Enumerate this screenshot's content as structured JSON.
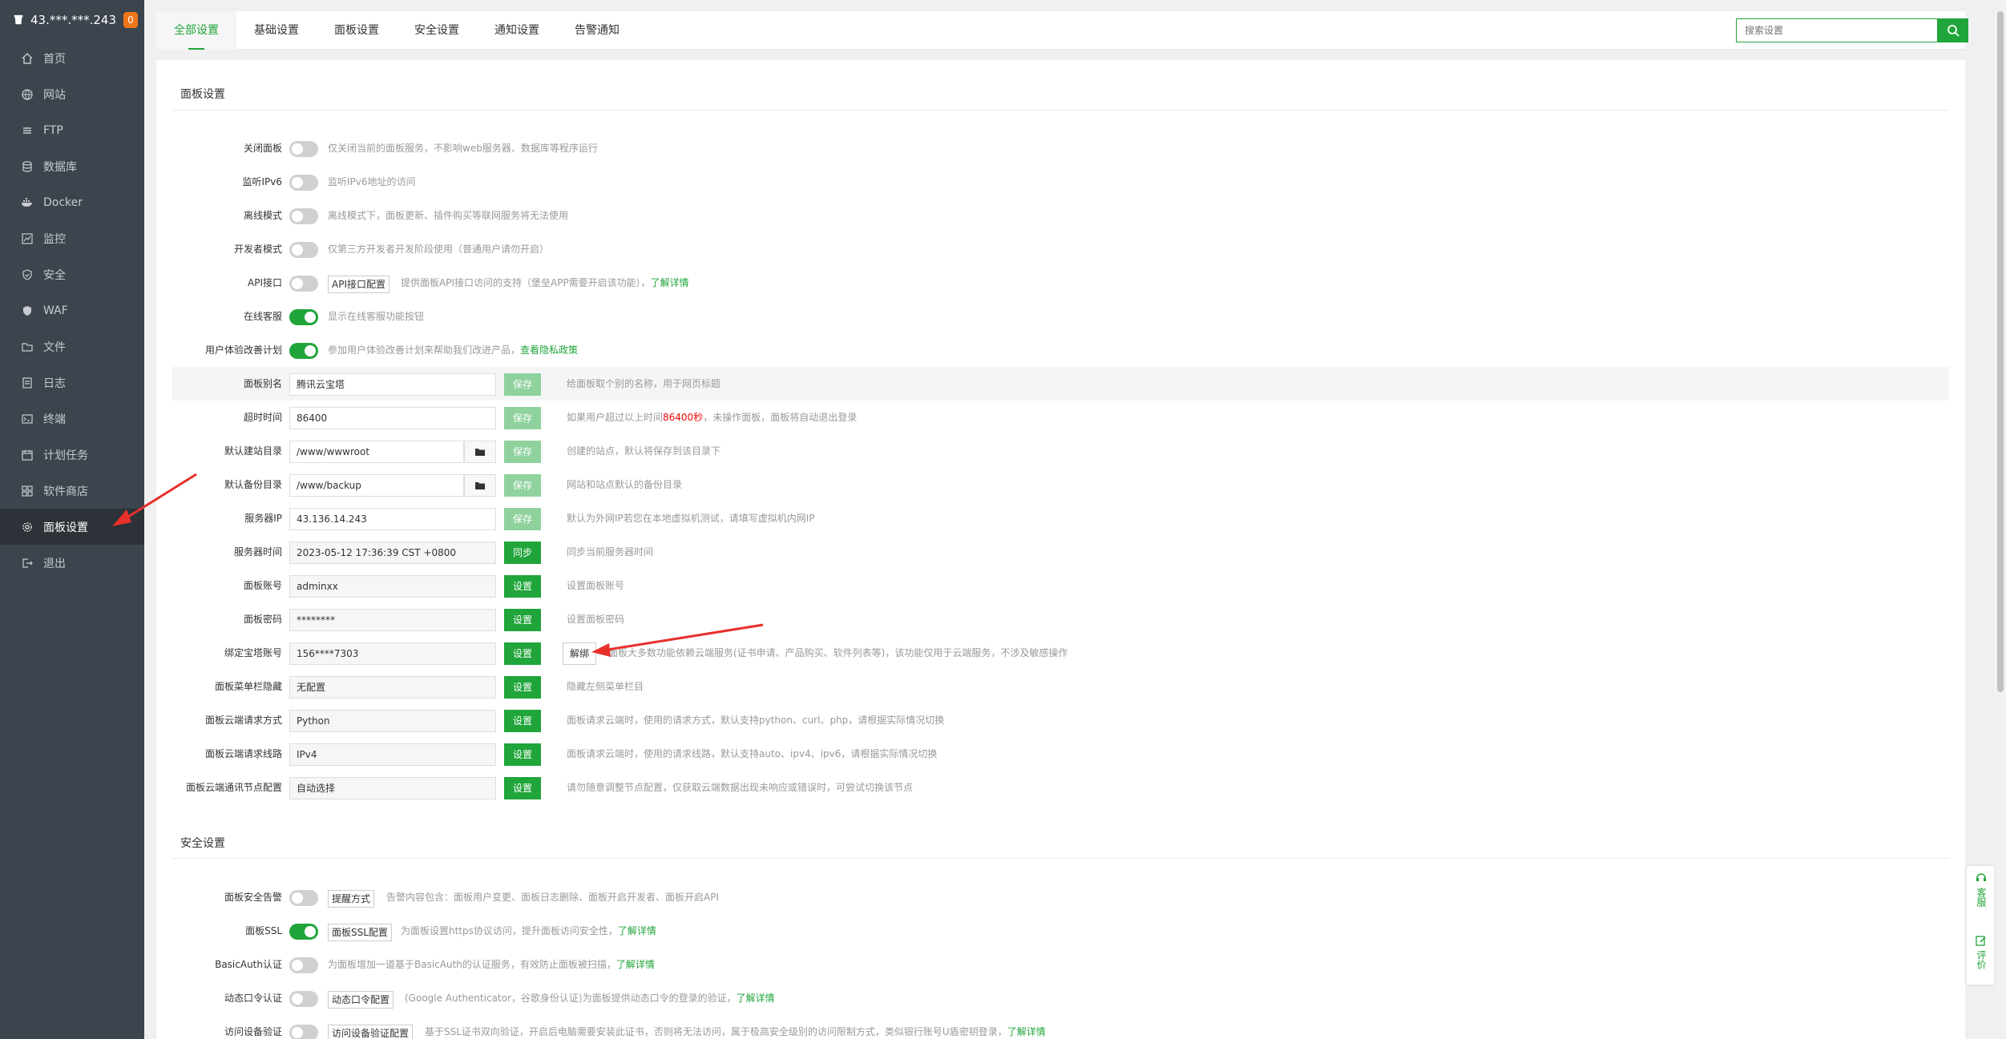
{
  "sidebar": {
    "server": "43.***.***.243",
    "badge": "0",
    "items": [
      {
        "label": "首页"
      },
      {
        "label": "网站"
      },
      {
        "label": "FTP"
      },
      {
        "label": "数据库"
      },
      {
        "label": "Docker"
      },
      {
        "label": "监控"
      },
      {
        "label": "安全"
      },
      {
        "label": "WAF"
      },
      {
        "label": "文件"
      },
      {
        "label": "日志"
      },
      {
        "label": "终端"
      },
      {
        "label": "计划任务"
      },
      {
        "label": "软件商店"
      },
      {
        "label": "面板设置"
      },
      {
        "label": "退出"
      }
    ]
  },
  "tabs": [
    "全部设置",
    "基础设置",
    "面板设置",
    "安全设置",
    "通知设置",
    "告警通知"
  ],
  "search": {
    "placeholder": "搜索设置"
  },
  "panel_section": {
    "title": "面板设置",
    "close_panel": {
      "label": "关闭面板",
      "desc": "仅关闭当前的面板服务，不影响web服务器、数据库等程序运行"
    },
    "ipv6": {
      "label": "监听IPv6",
      "desc": "监听IPv6地址的访问"
    },
    "offline": {
      "label": "离线模式",
      "desc": "离线模式下，面板更新、插件购买等联网服务将无法使用"
    },
    "dev_mode": {
      "label": "开发者模式",
      "desc": "仅第三方开发者开发阶段使用（普通用户请勿开启）"
    },
    "api": {
      "label": "API接口",
      "btn": "API接口配置",
      "desc": "提供面板API接口访问的支持（堡垒APP需要开启该功能），",
      "link": "了解详情"
    },
    "online_service": {
      "label": "在线客服",
      "desc": "显示在线客服功能按钮"
    },
    "ux_plan": {
      "label": "用户体验改善计划",
      "desc": "参加用户体验改善计划来帮助我们改进产品，",
      "link": "查看隐私政策"
    },
    "alias": {
      "label": "面板别名",
      "value": "腾讯云宝塔",
      "btn": "保存",
      "desc": "给面板取个别的名称，用于网页标题"
    },
    "timeout": {
      "label": "超时时间",
      "value": "86400",
      "btn": "保存",
      "desc_a": "如果用户超过以上时间",
      "desc_red": "86400秒",
      "desc_b": "，未操作面板，面板将自动退出登录"
    },
    "site_dir": {
      "label": "默认建站目录",
      "value": "/www/wwwroot",
      "btn": "保存",
      "desc": "创建的站点，默认将保存到该目录下"
    },
    "backup_dir": {
      "label": "默认备份目录",
      "value": "/www/backup",
      "btn": "保存",
      "desc": "网站和站点默认的备份目录"
    },
    "server_ip": {
      "label": "服务器IP",
      "value": "43.136.14.243",
      "btn": "保存",
      "desc": "默认为外网IP若您在本地虚拟机测试，请填写虚拟机内网IP"
    },
    "server_time": {
      "label": "服务器时间",
      "value": "2023-05-12 17:36:39 CST +0800",
      "btn": "同步",
      "desc": "同步当前服务器时间"
    },
    "account": {
      "label": "面板账号",
      "value": "adminxx",
      "btn": "设置",
      "desc": "设置面板账号"
    },
    "password": {
      "label": "面板密码",
      "value": "********",
      "btn": "设置",
      "desc": "设置面板密码"
    },
    "bt_account": {
      "label": "绑定宝塔账号",
      "value": "156****7303",
      "btn": "设置",
      "btn2": "解绑",
      "desc": "面板大多数功能依赖云端服务(证书申请、产品购买、软件列表等)，该功能仅用于云端服务，不涉及敏感操作"
    },
    "menu_hide": {
      "label": "面板菜单栏隐藏",
      "value": "无配置",
      "btn": "设置",
      "desc": "隐藏左侧菜单栏目"
    },
    "req_method": {
      "label": "面板云端请求方式",
      "value": "Python",
      "btn": "设置",
      "desc": "面板请求云端时，使用的请求方式，默认支持python、curl、php，请根据实际情况切换"
    },
    "req_line": {
      "label": "面板云端请求线路",
      "value": "IPv4",
      "btn": "设置",
      "desc": "面板请求云端时，使用的请求线路，默认支持auto、ipv4、ipv6，请根据实际情况切换"
    },
    "node": {
      "label": "面板云端通讯节点配置",
      "value": "自动选择",
      "btn": "设置",
      "desc": "请勿随意调整节点配置，仅获取云端数据出现未响应或错误时，可尝试切换该节点"
    }
  },
  "security_section": {
    "title": "安全设置",
    "alarm": {
      "label": "面板安全告警",
      "btn": "提醒方式",
      "desc": "告警内容包含：面板用户变更、面板日志删除、面板开启开发者、面板开启API"
    },
    "ssl": {
      "label": "面板SSL",
      "btn": "面板SSL配置",
      "desc": "为面板设置https协议访问，提升面板访问安全性，",
      "link": "了解详情"
    },
    "basic_auth": {
      "label": "BasicAuth认证",
      "desc": "为面板增加一道基于BasicAuth的认证服务，有效防止面板被扫描，",
      "link": "了解详情"
    },
    "totp": {
      "label": "动态口令认证",
      "btn": "动态口令配置",
      "desc": "(Google Authenticator，谷歌身份认证)为面板提供动态口令的登录的验证，",
      "link": "了解详情"
    },
    "device": {
      "label": "访问设备验证",
      "btn": "访问设备验证配置",
      "desc": "基于SSL证书双向验证，开启后电脑需要安装此证书，否则将无法访问，属于极高安全级别的访问限制方式，类似银行账号U盾密钥登录，",
      "link": "了解详情"
    }
  },
  "float": {
    "service": "客服",
    "review": "评价"
  },
  "colors": {
    "accent": "#20a53a",
    "sidebar": "#3c444d",
    "badge": "#f0761b",
    "annotation": "#e8302c"
  }
}
